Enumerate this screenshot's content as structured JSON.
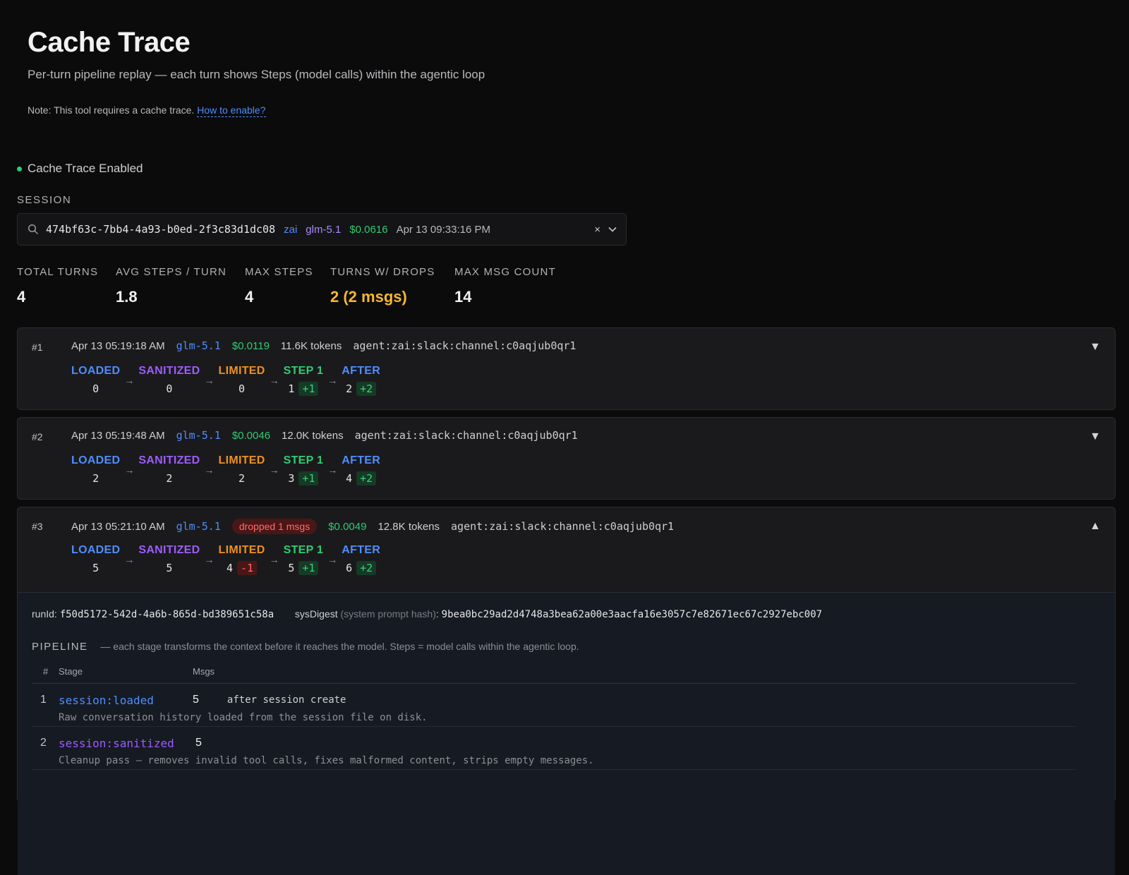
{
  "page": {
    "title": "Cache Trace",
    "subtitle": "Per-turn pipeline replay — each turn shows Steps (model calls) within the agentic loop",
    "note_prefix": "Note: This tool requires a cache trace.",
    "note_link": "How to enable?",
    "status": "Cache Trace Enabled",
    "session_label": "SESSION"
  },
  "colors": {
    "accent": "#4f8dff",
    "ok": "#2ecc71",
    "warn": "#f5b82e",
    "danger": "#ff6b6b",
    "purple": "#9d5cff",
    "orange": "#f0901c"
  },
  "session": {
    "id": "474bf63c-7bb4-4a93-b0ed-2f3c83d1dc08",
    "provider": "zai",
    "model": "glm-5.1",
    "cost": "$0.0616",
    "date": "Apr 13 09:33:16 PM",
    "clear_icon": "×",
    "dropdown_icon": "chevron-down"
  },
  "stats": [
    {
      "label": "TOTAL TURNS",
      "value": "4"
    },
    {
      "label": "AVG STEPS / TURN",
      "value": "1.8"
    },
    {
      "label": "MAX STEPS",
      "value": "4"
    },
    {
      "label": "TURNS W/ DROPS",
      "value": "2 (2 msgs)"
    },
    {
      "label": "MAX MSG COUNT",
      "value": "14"
    }
  ],
  "stage_labels": [
    "LOADED",
    "SANITIZED",
    "LIMITED",
    "STEP 1",
    "AFTER"
  ],
  "turns": [
    {
      "num": "#1",
      "date": "Apr 13 05:19:18 AM",
      "model": "glm-5.1",
      "cost": "$0.0119",
      "tokens": "11.6K tokens",
      "agent": "agent:zai:slack:channel:c0aqjub0qr1",
      "toggle": "▼",
      "vals": [
        "0",
        "0",
        "0",
        "1",
        "2"
      ],
      "deltas": [
        "",
        "",
        "",
        "+1",
        "+2"
      ]
    },
    {
      "num": "#2",
      "date": "Apr 13 05:19:48 AM",
      "model": "glm-5.1",
      "cost": "$0.0046",
      "tokens": "12.0K tokens",
      "agent": "agent:zai:slack:channel:c0aqjub0qr1",
      "toggle": "▼",
      "vals": [
        "2",
        "2",
        "2",
        "3",
        "4"
      ],
      "deltas": [
        "",
        "",
        "",
        "+1",
        "+2"
      ]
    },
    {
      "num": "#3",
      "date": "Apr 13 05:21:10 AM",
      "model": "glm-5.1",
      "drop": "dropped 1 msgs",
      "cost": "$0.0049",
      "tokens": "12.8K tokens",
      "agent": "agent:zai:slack:channel:c0aqjub0qr1",
      "toggle": "▲",
      "vals": [
        "5",
        "5",
        "4",
        "5",
        "6"
      ],
      "deltas": [
        "",
        "",
        "-1",
        "+1",
        "+2"
      ]
    }
  ],
  "detail": {
    "run_key": "runId:",
    "run_id": "f50d5172-542d-4a6b-865d-bd389651c58a",
    "sys_key": "sysDigest",
    "sys_hint": "(system prompt hash)",
    "sys_colon": ":",
    "sys_digest": "9bea0bc29ad2d4748a3bea62a00e3aacfa16e3057c7e82671ec67c2927ebc007",
    "pipeline_title": "PIPELINE",
    "pipeline_desc": "— each stage transforms the context before it reaches the model. Steps = model calls within the agentic loop.",
    "headers": {
      "num": "#",
      "stage": "Stage",
      "msgs": "Msgs"
    },
    "rows": [
      {
        "n": "1",
        "stage": "session:loaded",
        "msgs": "5",
        "inline": "after session create",
        "desc": "Raw conversation history loaded from the session file on disk."
      },
      {
        "n": "2",
        "stage": "session:sanitized",
        "msgs": "5",
        "inline": "",
        "desc": "Cleanup pass — removes invalid tool calls, fixes malformed content, strips empty messages."
      }
    ]
  }
}
